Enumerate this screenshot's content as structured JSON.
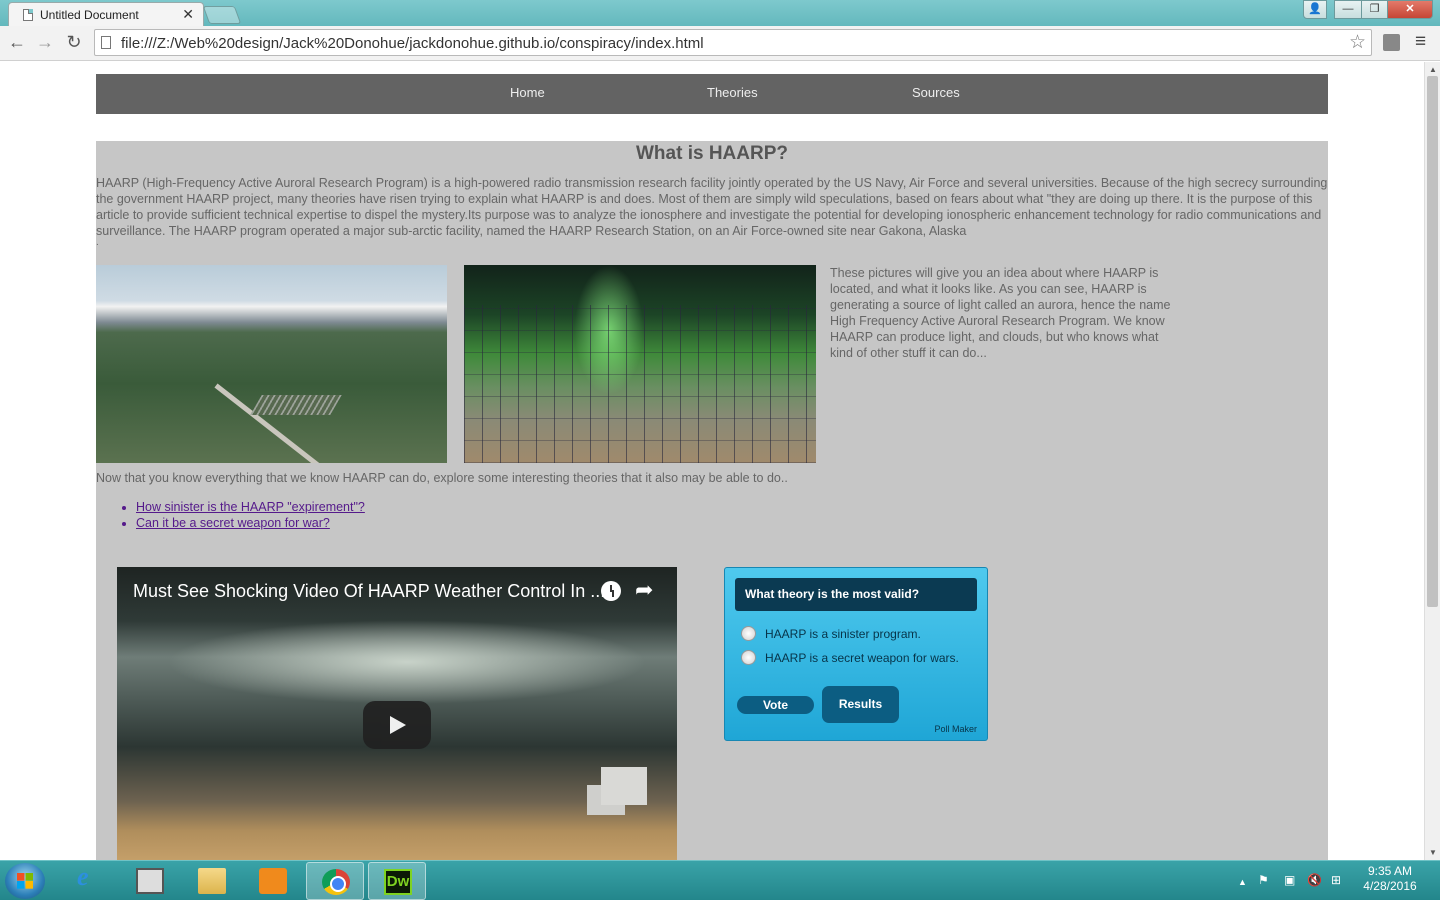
{
  "browser": {
    "tab_title": "Untitled Document",
    "tab_close": "✕",
    "url": "file:///Z:/Web%20design/Jack%20Donohue/jackdonohue.github.io/conspiracy/index.html",
    "back": "←",
    "forward": "→",
    "reload": "↻",
    "star": "☆",
    "menu": "≡",
    "window_controls": {
      "minimize": "—",
      "maximize": "❐",
      "close": "✕",
      "user": "👤"
    }
  },
  "page": {
    "nav": [
      "Home",
      "Theories",
      "Sources"
    ],
    "title": "What is HAARP?",
    "intro": "HAARP (High-Frequency Active Auroral Research Program) is a high-powered radio transmission research facility jointly operated by the US Navy, Air Force and several universities. Because of the high secrecy surrounding the government HAARP project, many theories have risen trying to explain what HAARP is and does. Most of them are simply wild speculations, based on fears about what \"they are doing up there. It is the purpose of this article to provide sufficient technical expertise to dispel the mystery.Its purpose was to analyze the ionosphere and investigate the potential for developing ionospheric enhancement technology for radio communications and surveillance. The HAARP program operated a major sub-arctic facility, named the HAARP Research Station, on an Air Force-owned site near Gakona, Alaska",
    "intro_trailing": ".",
    "photo_caption": "These pictures will give you an idea about where HAARP is located, and what it looks like. As you can see, HAARP is generating a source of light called an aurora, hence the name High Frequency Active Auroral Research Program. We know HAARP can produce light, and clouds, but who knows what kind of other stuff it can do...",
    "explore_text": "Now that you know everything that we know HAARP can do, explore some interesting theories that it also may be able to do..",
    "theory_links": [
      "How sinister is the HAARP \"expirement\"?",
      "Can it be a secret weapon for war?"
    ],
    "video": {
      "title": "Must See Shocking Video Of HAARP Weather Control In ..."
    },
    "poll": {
      "question": "What theory is the most valid?",
      "options": [
        "HAARP is a sinister program.",
        "HAARP is a secret weapon for wars."
      ],
      "vote_label": "Vote",
      "results_label": "Results",
      "credit": "Poll Maker"
    }
  },
  "taskbar": {
    "apps": [
      "internet-explorer",
      "explorer",
      "file-manager",
      "media-player",
      "chrome",
      "dreamweaver"
    ],
    "dw_label": "Dw",
    "ie_label": "e",
    "time": "9:35 AM",
    "date": "4/28/2016"
  }
}
